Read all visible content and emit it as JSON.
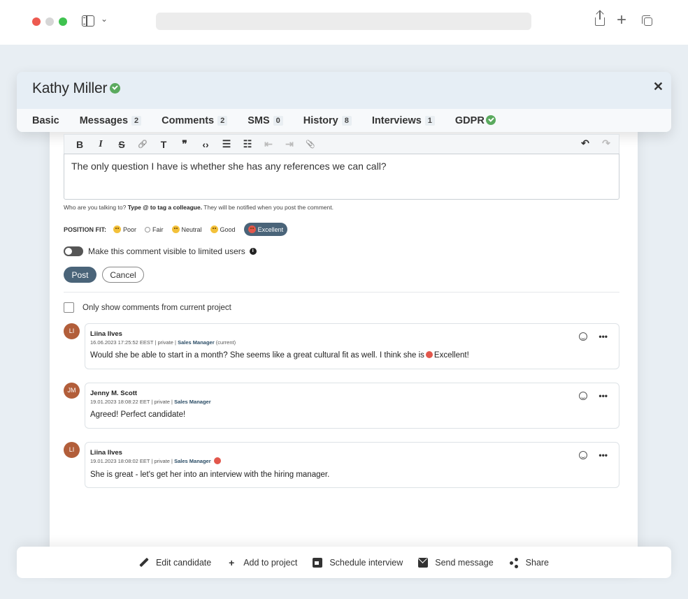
{
  "candidate": {
    "name": "Kathy Miller"
  },
  "tabs": [
    {
      "label": "Basic",
      "count": ""
    },
    {
      "label": "Messages",
      "count": "2"
    },
    {
      "label": "Comments",
      "count": "2"
    },
    {
      "label": "SMS",
      "count": "0"
    },
    {
      "label": "History",
      "count": "8"
    },
    {
      "label": "Interviews",
      "count": "1"
    },
    {
      "label": "GDPR",
      "count": ""
    }
  ],
  "toolbar": {
    "bold": "B",
    "italic": "I",
    "strike": "S",
    "link": "🔗",
    "heading": "T",
    "quote": "❞",
    "code": "‹›",
    "ul": "☰",
    "ol": "☷",
    "outdent": "⇤",
    "indent": "⇥",
    "attach": "📎",
    "undo": "↶",
    "redo": "↷"
  },
  "editor": {
    "text": "The only question I have is whether she has any references we can call?"
  },
  "hint": {
    "prefix": "Who are you talking to?",
    "bold": "Type @ to tag a colleague.",
    "suffix": "They will be notified when you post the comment."
  },
  "position_fit": {
    "label": "POSITION FIT:",
    "options": [
      "Poor",
      "Fair",
      "Neutral",
      "Good",
      "Excellent"
    ],
    "selected": "Excellent"
  },
  "visibility_toggle": {
    "label": "Make this comment visible to limited users",
    "info": "i"
  },
  "buttons": {
    "post": "Post",
    "cancel": "Cancel"
  },
  "filter": {
    "label": "Only show comments from current project"
  },
  "comments": [
    {
      "initials": "LI",
      "author": "Liina Ilves",
      "meta": "16.06.2023 17:25:52 EEST | private |",
      "role": "Sales Manager",
      "role_suffix": "(current)",
      "text_before": "Would she be able to start in a month? She seems like a great cultural fit as well. I think she is",
      "text_after": "Excellent!"
    },
    {
      "initials": "JM",
      "author": "Jenny M. Scott",
      "meta": "19.01.2023 18:08:22 EET | private |",
      "role": "Sales Manager",
      "text": "Agreed! Perfect candidate!"
    },
    {
      "initials": "LI",
      "author": "Liina Ilves",
      "meta": "19.01.2023 18:08:02 EET | private |",
      "role": "Sales Manager",
      "text": "She is great - let's get her into an interview with the hiring manager."
    }
  ],
  "actions": {
    "edit": "Edit candidate",
    "add": "Add to project",
    "schedule": "Schedule interview",
    "message": "Send message",
    "share": "Share"
  },
  "colors": {
    "accent": "#4a6479",
    "success": "#5aaa5e",
    "avatar": "#b25e3a"
  }
}
